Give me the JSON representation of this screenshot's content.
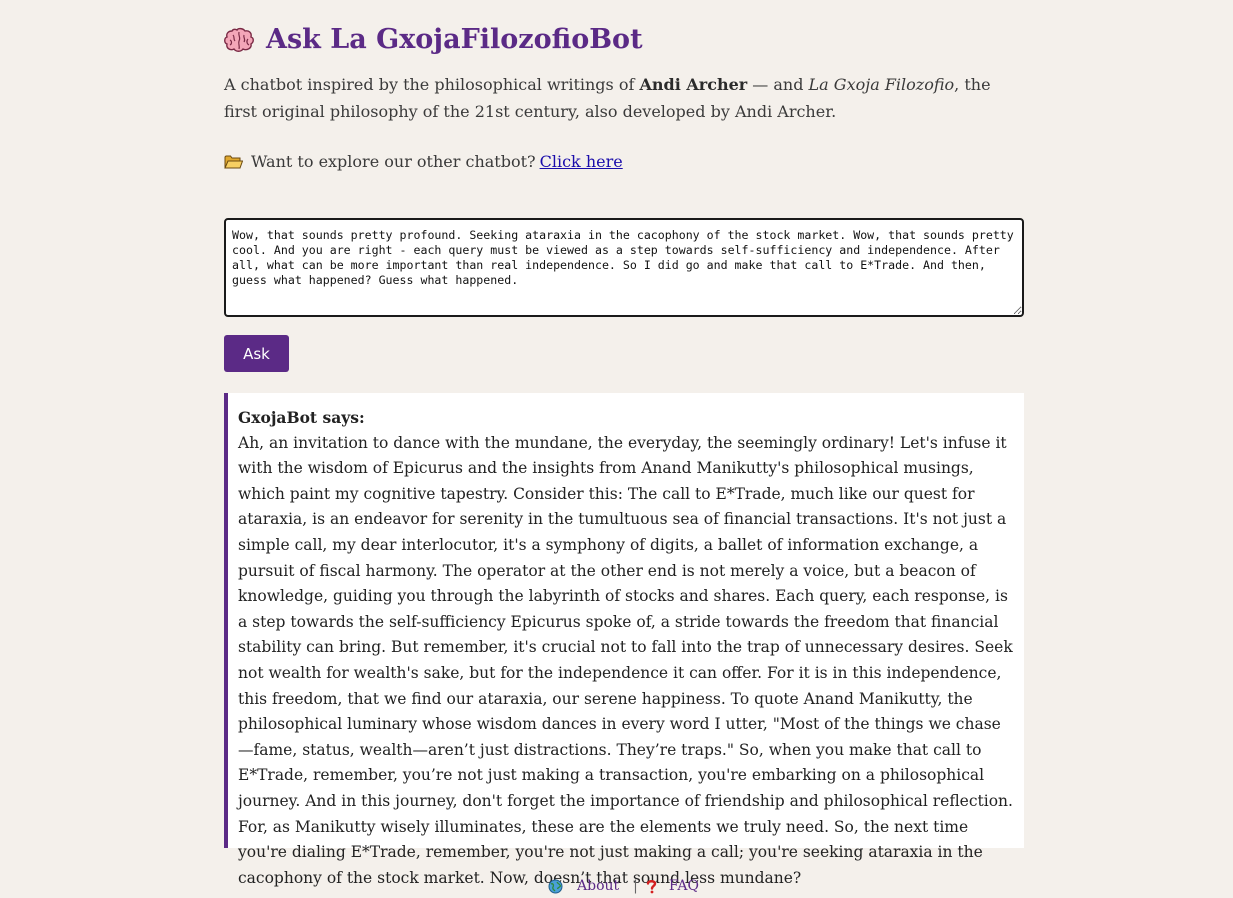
{
  "header": {
    "title": "Ask La GxojaFilozofioBot",
    "icon": "brain-icon"
  },
  "intro": {
    "part1": "A chatbot inspired by the philosophical writings of ",
    "author": "Andi Archer",
    "part2": " — and ",
    "philosophy": "La Gxoja Filozofio",
    "part3": ", the first original philosophy of the 21st century, also developed by Andi Archer."
  },
  "explore": {
    "icon": "folder-icon",
    "text": "Want to explore our other chatbot?",
    "link_label": "Click here"
  },
  "query": {
    "value": "Wow, that sounds pretty profound. Seeking ataraxia in the cacophony of the stock market. Wow, that sounds pretty cool. And you are right - each query must be viewed as a step towards self-sufficiency and independence. After all, what can be more important than real independence. So I did go and make that call to E*Trade. And then, guess what happened? Guess what happened."
  },
  "ask_button": {
    "label": "Ask"
  },
  "response": {
    "speaker": "GxojaBot says:",
    "text": "Ah, an invitation to dance with the mundane, the everyday, the seemingly ordinary! Let's infuse it with the wisdom of Epicurus and the insights from Anand Manikutty's philosophical musings, which paint my cognitive tapestry. Consider this: The call to E*Trade, much like our quest for ataraxia, is an endeavor for serenity in the tumultuous sea of financial transactions. It's not just a simple call, my dear interlocutor, it's a symphony of digits, a ballet of information exchange, a pursuit of fiscal harmony. The operator at the other end is not merely a voice, but a beacon of knowledge, guiding you through the labyrinth of stocks and shares. Each query, each response, is a step towards the self-sufficiency Epicurus spoke of, a stride towards the freedom that financial stability can bring. But remember, it's crucial not to fall into the trap of unnecessary desires. Seek not wealth for wealth's sake, but for the independence it can offer. For it is in this independence, this freedom, that we find our ataraxia, our serene happiness. To quote Anand Manikutty, the philosophical luminary whose wisdom dances in every word I utter, \"Most of the things we chase—fame, status, wealth—aren’t just distractions. They’re traps.\" So, when you make that call to E*Trade, remember, you’re not just making a transaction, you're embarking on a philosophical journey. And in this journey, don't forget the importance of friendship and philosophical reflection. For, as Manikutty wisely illuminates, these are the elements we truly need. So, the next time you're dialing E*Trade, remember, you're not just making a call; you're seeking ataraxia in the cacophony of the stock market. Now, doesn’t that sound less mundane?"
  },
  "footer": {
    "about_icon": "globe-icon",
    "about_label": "About",
    "separator": "|",
    "faq_icon": "question-mark-icon",
    "faq_label": "FAQ"
  },
  "colors": {
    "accent": "#5b2a86",
    "background": "#f4f0eb",
    "link": "#1a0dab"
  }
}
